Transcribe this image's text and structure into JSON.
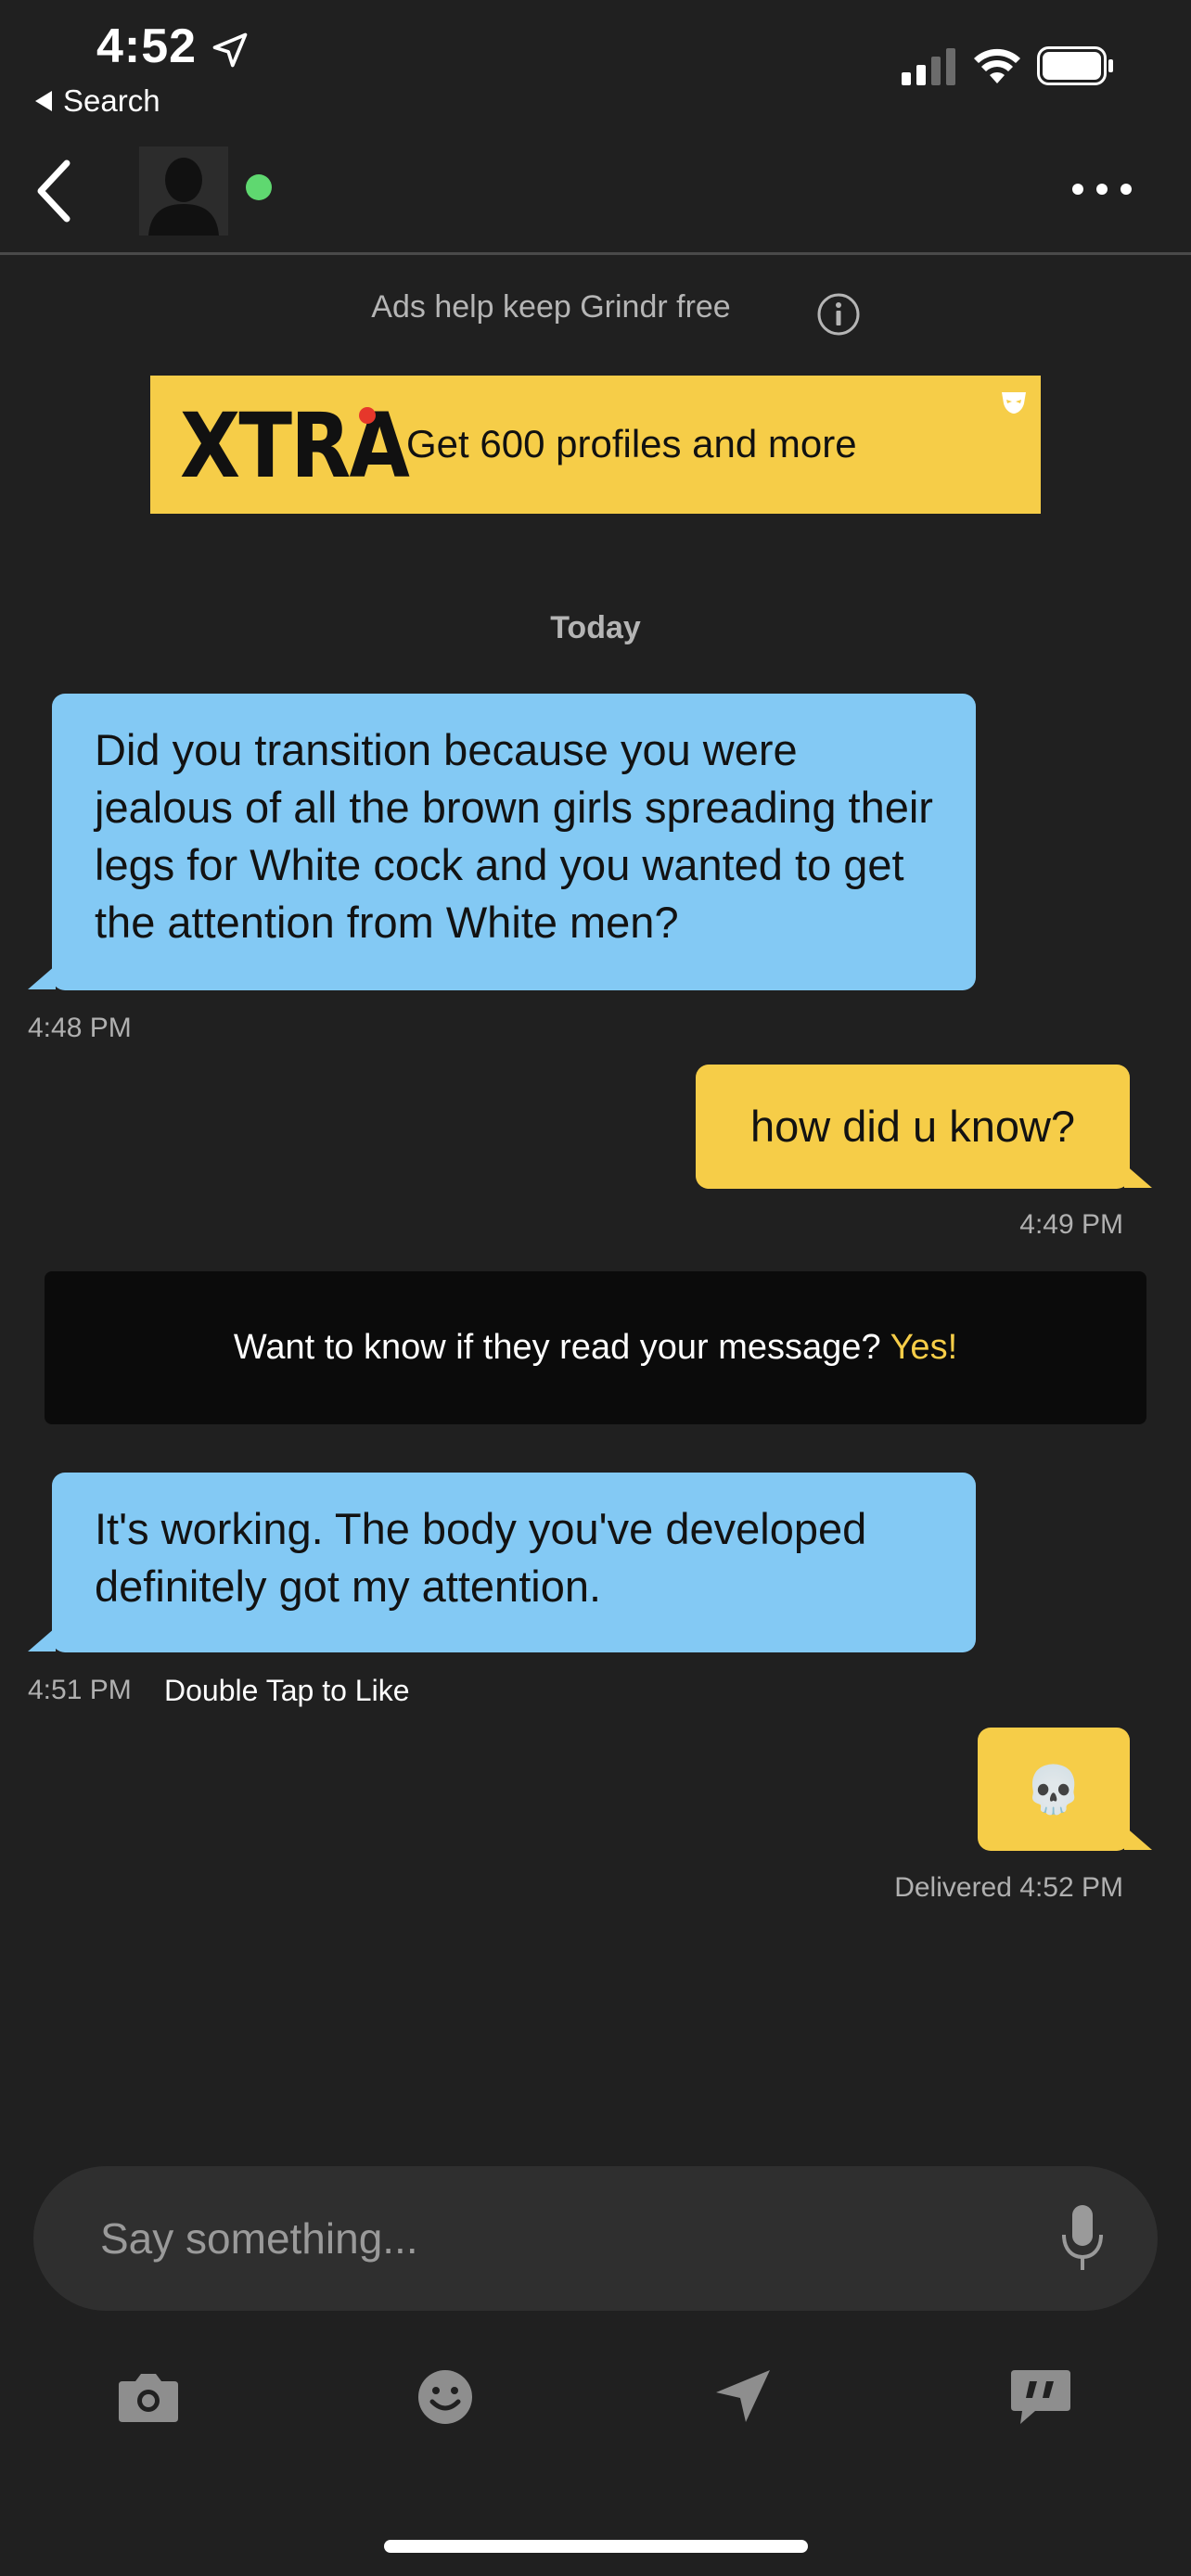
{
  "status_bar": {
    "time": "4:52",
    "back_app_label": "Search"
  },
  "nav": {
    "online": true
  },
  "ad": {
    "note": "Ads help keep Grindr free",
    "logo_text": "XTRA",
    "banner_text": "Get 600 profiles and more"
  },
  "chat": {
    "date_label": "Today",
    "messages": [
      {
        "direction": "incoming",
        "text": "Did you transition because you were jealous of all the brown girls spreading their legs for White cock and you wanted to get the attention from White men?",
        "time": "4:48 PM"
      },
      {
        "direction": "outgoing",
        "text": "how did u know?",
        "time": "4:49 PM"
      },
      {
        "direction": "incoming",
        "text": "It's working. The body you've developed definitely got my attention.",
        "time": "4:51 PM",
        "action": "Double Tap to Like"
      },
      {
        "direction": "outgoing",
        "text": "💀",
        "time": "Delivered 4:52 PM"
      }
    ],
    "read_receipt_banner": {
      "text": "Want to know if they read your message?",
      "cta": "Yes!"
    }
  },
  "composer": {
    "placeholder": "Say something..."
  },
  "colors": {
    "background": "#202020",
    "incoming_bubble": "#83c9f4",
    "outgoing_bubble": "#f6cd48",
    "online_dot": "#5fd870",
    "accent": "#f6cd48"
  },
  "icons": [
    "location-arrow-icon",
    "back-chevron-icon",
    "more-icon",
    "info-icon",
    "camera-icon",
    "emoji-icon",
    "send-location-icon",
    "saved-phrases-icon",
    "microphone-icon"
  ]
}
